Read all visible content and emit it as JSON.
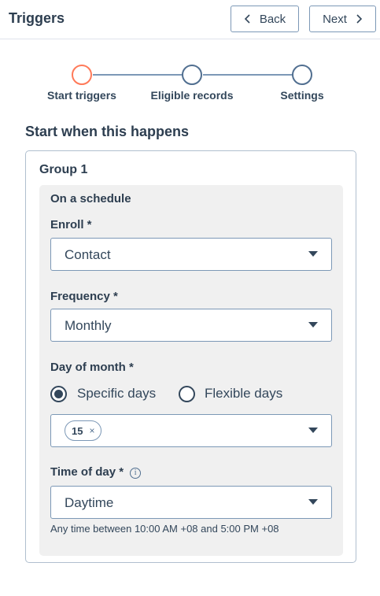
{
  "header": {
    "title": "Triggers",
    "back_label": "Back",
    "next_label": "Next"
  },
  "stepper": {
    "steps": [
      {
        "label": "Start triggers",
        "state": "active"
      },
      {
        "label": "Eligible records",
        "state": "pending"
      },
      {
        "label": "Settings",
        "state": "pending"
      }
    ],
    "accent_color": "#ff7a59"
  },
  "section": {
    "title": "Start when this happens"
  },
  "group": {
    "title": "Group 1",
    "subtitle": "On a schedule",
    "enroll": {
      "label": "Enroll *",
      "value": "Contact"
    },
    "frequency": {
      "label": "Frequency *",
      "value": "Monthly"
    },
    "day_of_month": {
      "label": "Day of month *",
      "options": [
        {
          "label": "Specific days",
          "checked": true
        },
        {
          "label": "Flexible days",
          "checked": false
        }
      ],
      "selected_tags": [
        "15"
      ],
      "tag_remove": "×"
    },
    "time_of_day": {
      "label": "Time of day *",
      "info": "i",
      "value": "Daytime",
      "helper": "Any time between 10:00 AM +08 and 5:00 PM +08"
    }
  }
}
